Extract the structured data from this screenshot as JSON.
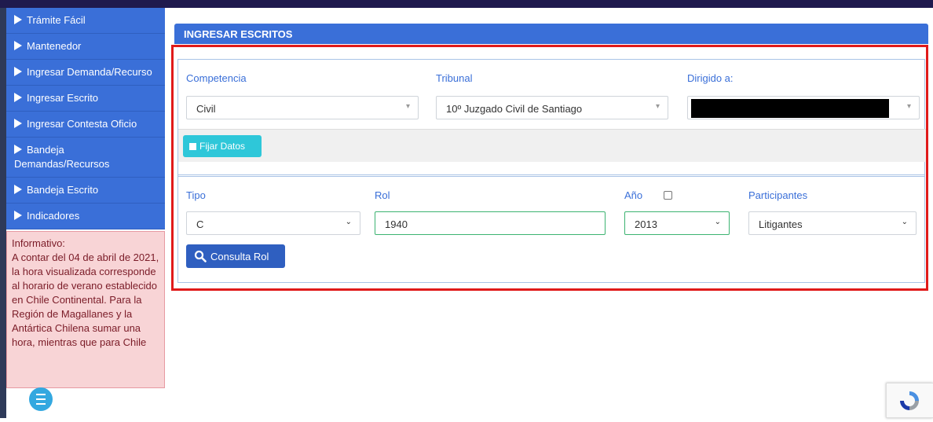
{
  "sidebar": {
    "items": [
      {
        "label": "Trámite Fácil"
      },
      {
        "label": "Mantenedor"
      },
      {
        "label": "Ingresar Demanda/Recurso"
      },
      {
        "label": "Ingresar Escrito"
      },
      {
        "label": "Ingresar Contesta Oficio"
      },
      {
        "label": "Bandeja Demandas/Recursos"
      },
      {
        "label": "Bandeja Escrito"
      },
      {
        "label": "Indicadores"
      }
    ],
    "info_title": "Informativo:",
    "info_text": "A contar del 04 de abril de 2021, la hora visualizada corresponde al horario de verano establecido en Chile Continental. Para la Región de Magallanes y la Antártica Chilena sumar una hora, mientras que para Chile"
  },
  "panel": {
    "title": "INGRESAR ESCRITOS",
    "competencia_label": "Competencia",
    "competencia_value": "Civil",
    "tribunal_label": "Tribunal",
    "tribunal_value": "10º Juzgado Civil de Santiago",
    "dirigido_label": "Dirigido a:",
    "fijar_label": "Fijar Datos",
    "tipo_label": "Tipo",
    "tipo_value": "C",
    "rol_label": "Rol",
    "rol_value": "1940",
    "anio_label": "Año",
    "anio_value": "2013",
    "participantes_label": "Participantes",
    "participantes_value": "Litigantes",
    "consulta_label": "Consulta Rol"
  },
  "colors": {
    "accent": "#3a6fd8",
    "highlight_frame": "#e01a1a",
    "info_bg": "#f8d4d6",
    "fijar_button": "#2ec7d9"
  },
  "icons": [
    "caret-right-icon",
    "search-icon",
    "menu-icon",
    "recaptcha-icon",
    "chevron-down-icon"
  ]
}
